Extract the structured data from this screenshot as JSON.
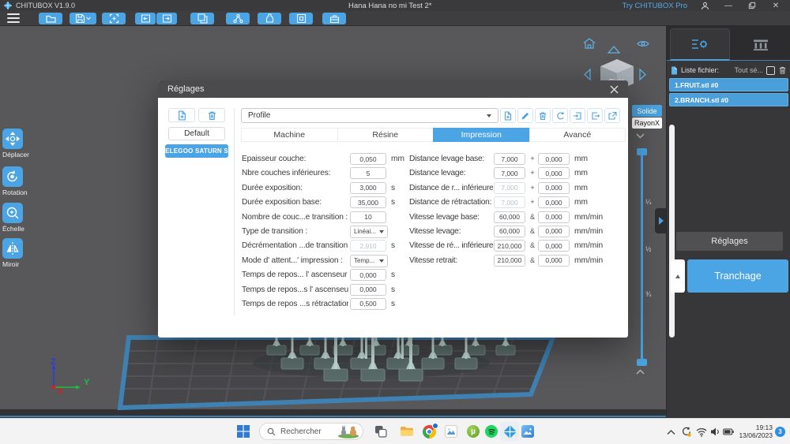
{
  "window": {
    "app_name": "CHITUBOX V1.9.0",
    "doc_title": "Hana Hana no mi Test 2*",
    "pro_link": "Try CHITUBOX Pro"
  },
  "toolbar": {
    "buttons": [
      "open-file",
      "save",
      "auto-layout",
      "undo",
      "redo",
      "clone",
      "support-edit",
      "resin-detect",
      "hollow",
      "toolbox"
    ]
  },
  "left_tools": [
    {
      "label": "Déplacer",
      "icon": "move-icon"
    },
    {
      "label": "Rotation",
      "icon": "rotate-icon"
    },
    {
      "label": "Échelle",
      "icon": "scale-icon"
    },
    {
      "label": "Miroir",
      "icon": "mirror-icon"
    }
  ],
  "viewport": {
    "cube_face": "Right",
    "view_modes": [
      {
        "label": "Solide",
        "active": true
      },
      {
        "label": "RayonX",
        "active": false
      }
    ],
    "slider_marks": [
      "¼",
      "½",
      "¾"
    ],
    "axes": {
      "x": "X",
      "y": "Y",
      "z": "Z"
    }
  },
  "dialog": {
    "title": "Réglages",
    "machine_panel": {
      "default_label": "Default",
      "machines": [
        {
          "name": "ELEGOO SATURN S",
          "selected": true
        }
      ]
    },
    "profile_value": "Profile",
    "tabs": [
      {
        "label": "Machine",
        "active": false
      },
      {
        "label": "Résine",
        "active": false
      },
      {
        "label": "Impression",
        "active": true
      },
      {
        "label": "Avancé",
        "active": false
      }
    ],
    "params_left": [
      {
        "label": "Épaisseur couche:",
        "value": "0,050",
        "unit": "mm"
      },
      {
        "label": "Nbre couches inférieures:",
        "value": "5",
        "unit": ""
      },
      {
        "label": "Durée exposition:",
        "value": "3,000",
        "unit": "s"
      },
      {
        "label": "Durée exposition base:",
        "value": "35,000",
        "unit": "s"
      },
      {
        "label": "Nombre de couc...e transition :",
        "value": "10",
        "unit": ""
      },
      {
        "label": "Type de transition :",
        "value": "Linéai...",
        "unit": "",
        "control": "dropdown"
      },
      {
        "label": "Décrémentation ...de transition :",
        "value": "2,910",
        "unit": "s",
        "disabled": true
      },
      {
        "label": "Mode d' attent...' impression :",
        "value": "Temp...",
        "unit": "",
        "control": "dropdown"
      },
      {
        "label": "Temps de repos... l' ascenseur :",
        "value": "0,000",
        "unit": "s"
      },
      {
        "label": "Temps de repos...s l' ascenseur:",
        "value": "0,000",
        "unit": "s"
      },
      {
        "label": "Temps de repos ...s rétractation:",
        "value": "0,500",
        "unit": "s"
      }
    ],
    "params_right": [
      {
        "label": "Distance levage base:",
        "value1": "7,000",
        "op": "+",
        "value2": "0,000",
        "unit": "mm"
      },
      {
        "label": "Distance levage:",
        "value1": "7,000",
        "op": "+",
        "value2": "0,000",
        "unit": "mm"
      },
      {
        "label": "Distance de r... inférieure :",
        "value1": "7,000",
        "op": "+",
        "value2": "0,000",
        "unit": "mm",
        "disabled1": true
      },
      {
        "label": "Distance de rétractation:",
        "value1": "7,000",
        "op": "+",
        "value2": "0,000",
        "unit": "mm",
        "disabled1": true
      },
      {
        "label": "Vitesse levage base:",
        "value1": "60,000",
        "op": "&",
        "value2": "0,000",
        "unit": "mm/min"
      },
      {
        "label": "Vitesse levage:",
        "value1": "60,000",
        "op": "&",
        "value2": "0,000",
        "unit": "mm/min"
      },
      {
        "label": "Vitesse de ré... inférieure :",
        "value1": "210,000",
        "op": "&",
        "value2": "0,000",
        "unit": "mm/min"
      },
      {
        "label": "Vitesse retrait:",
        "value1": "210,000",
        "op": "&",
        "value2": "0,000",
        "unit": "mm/min"
      }
    ]
  },
  "right_panel": {
    "file_list_label": "Liste fichier:",
    "select_all_label": "Tout sé...",
    "files": [
      {
        "name": "1.FRUIT.stl #0"
      },
      {
        "name": "2.BRANCH.stl #0"
      }
    ],
    "settings_button": "Réglages",
    "slice_button": "Tranchage"
  },
  "taskbar": {
    "search_text": "Rechercher",
    "utorrent_glyph": "µ",
    "apps": [
      "task-view",
      "file-explorer",
      "chrome",
      "media-app",
      "utorrent",
      "spotify",
      "chitubox",
      "photos"
    ],
    "tray": {
      "time": "19:13",
      "date": "13/06/2023",
      "badge": "3"
    }
  }
}
